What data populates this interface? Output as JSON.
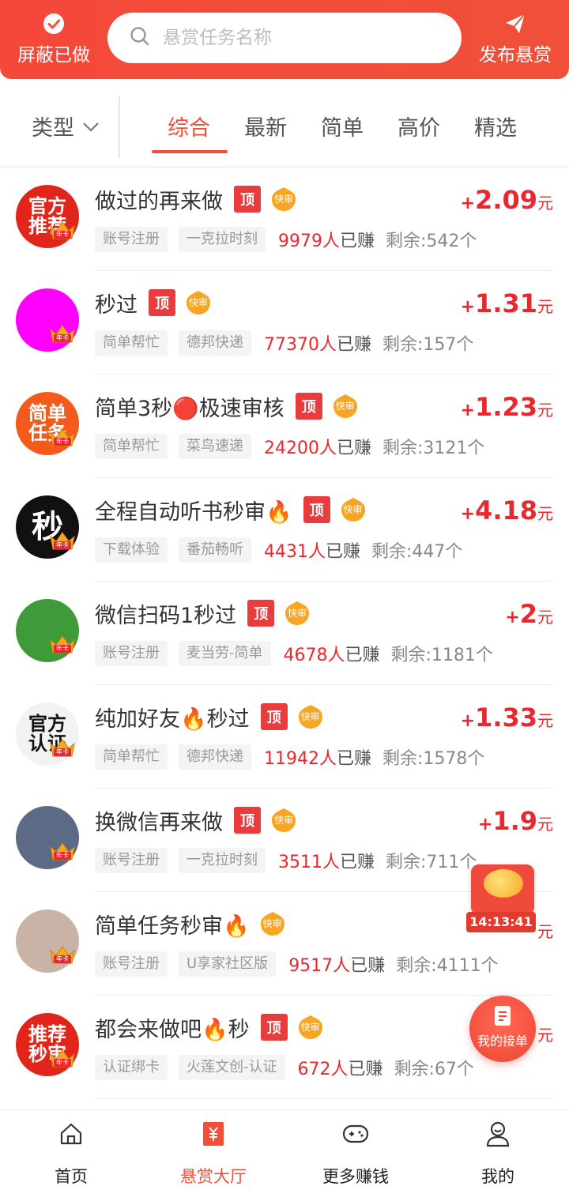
{
  "header": {
    "left_button": "屏蔽已做",
    "search_placeholder": "悬赏任务名称",
    "right_button": "发布悬赏"
  },
  "filter": {
    "type_label": "类型",
    "tabs": [
      "综合",
      "最新",
      "简单",
      "高价",
      "精选"
    ],
    "active_tab": "综合"
  },
  "badges": {
    "top": "顶",
    "fast": "快审",
    "annual": "年卡"
  },
  "tasks": [
    {
      "avatar_text": "官方推荐",
      "avatar_color": "#e1251b",
      "title": "做过的再来做",
      "top": true,
      "fast": true,
      "reward": "2.09",
      "unit": "元",
      "tags": [
        "账号注册",
        "一克拉时刻"
      ],
      "earned_count": "9979人",
      "earned_suffix": "已赚",
      "remaining": "剩余:542个"
    },
    {
      "avatar_text": "",
      "avatar_color": "#ff00ff",
      "title": "秒过",
      "top": true,
      "fast": true,
      "reward": "1.31",
      "unit": "元",
      "tags": [
        "简单帮忙",
        "德邦快递"
      ],
      "earned_count": "77370人",
      "earned_suffix": "已赚",
      "remaining": "剩余:157个"
    },
    {
      "avatar_text": "简单任务",
      "avatar_color": "#f35a1c",
      "title": "简单3秒🔴极速审核",
      "top": true,
      "fast": true,
      "reward": "1.23",
      "unit": "元",
      "tags": [
        "简单帮忙",
        "菜鸟速递"
      ],
      "earned_count": "24200人",
      "earned_suffix": "已赚",
      "remaining": "剩余:3121个"
    },
    {
      "avatar_text": "秒",
      "avatar_color": "#111111",
      "title": "全程自动听书秒审🔥",
      "top": true,
      "fast": true,
      "reward": "4.18",
      "unit": "元",
      "tags": [
        "下载体验",
        "番茄畅听"
      ],
      "earned_count": "4431人",
      "earned_suffix": "已赚",
      "remaining": "剩余:447个"
    },
    {
      "avatar_text": "",
      "avatar_color": "#3f9a3a",
      "title": "微信扫码1秒过",
      "top": true,
      "fast": true,
      "reward": "2",
      "unit": "元",
      "tags": [
        "账号注册",
        "麦当劳-简单"
      ],
      "earned_count": "4678人",
      "earned_suffix": "已赚",
      "remaining": "剩余:1181个"
    },
    {
      "avatar_text": "官方认证",
      "avatar_color": "#f2f2f2",
      "title": "纯加好友🔥秒过",
      "top": true,
      "fast": true,
      "reward": "1.33",
      "unit": "元",
      "tags": [
        "简单帮忙",
        "德邦快递"
      ],
      "earned_count": "11942人",
      "earned_suffix": "已赚",
      "remaining": "剩余:1578个"
    },
    {
      "avatar_text": "",
      "avatar_color": "#5c6a86",
      "title": "换微信再来做",
      "top": true,
      "fast": true,
      "reward": "1.9",
      "unit": "元",
      "tags": [
        "账号注册",
        "一克拉时刻"
      ],
      "earned_count": "3511人",
      "earned_suffix": "已赚",
      "remaining": "剩余:711个"
    },
    {
      "avatar_text": "",
      "avatar_color": "#c9b2a6",
      "title": "简单任务秒审🔥",
      "top": false,
      "fast": true,
      "reward": "",
      "unit": "元",
      "tags": [
        "账号注册",
        "U享家社区版"
      ],
      "earned_count": "9517人",
      "earned_suffix": "已赚",
      "remaining": "剩余:4111个"
    },
    {
      "avatar_text": "推荐秒审",
      "avatar_color": "#e1251b",
      "title": "都会来做吧🔥秒",
      "top": true,
      "fast": true,
      "reward": "",
      "unit": "元",
      "tags": [
        "认证绑卡",
        "火莲文创-认证"
      ],
      "earned_count": "672人",
      "earned_suffix": "已赚",
      "remaining": "剩余:67个"
    }
  ],
  "float_timer": "14:13:41",
  "float_order": "我的接单",
  "nav": {
    "items": [
      "首页",
      "悬赏大厅",
      "更多赚钱",
      "我的"
    ],
    "active": "悬赏大厅"
  },
  "colors": {
    "brand": "#f0503a",
    "reward": "#e8282e",
    "top_badge": "#e93c3c"
  }
}
